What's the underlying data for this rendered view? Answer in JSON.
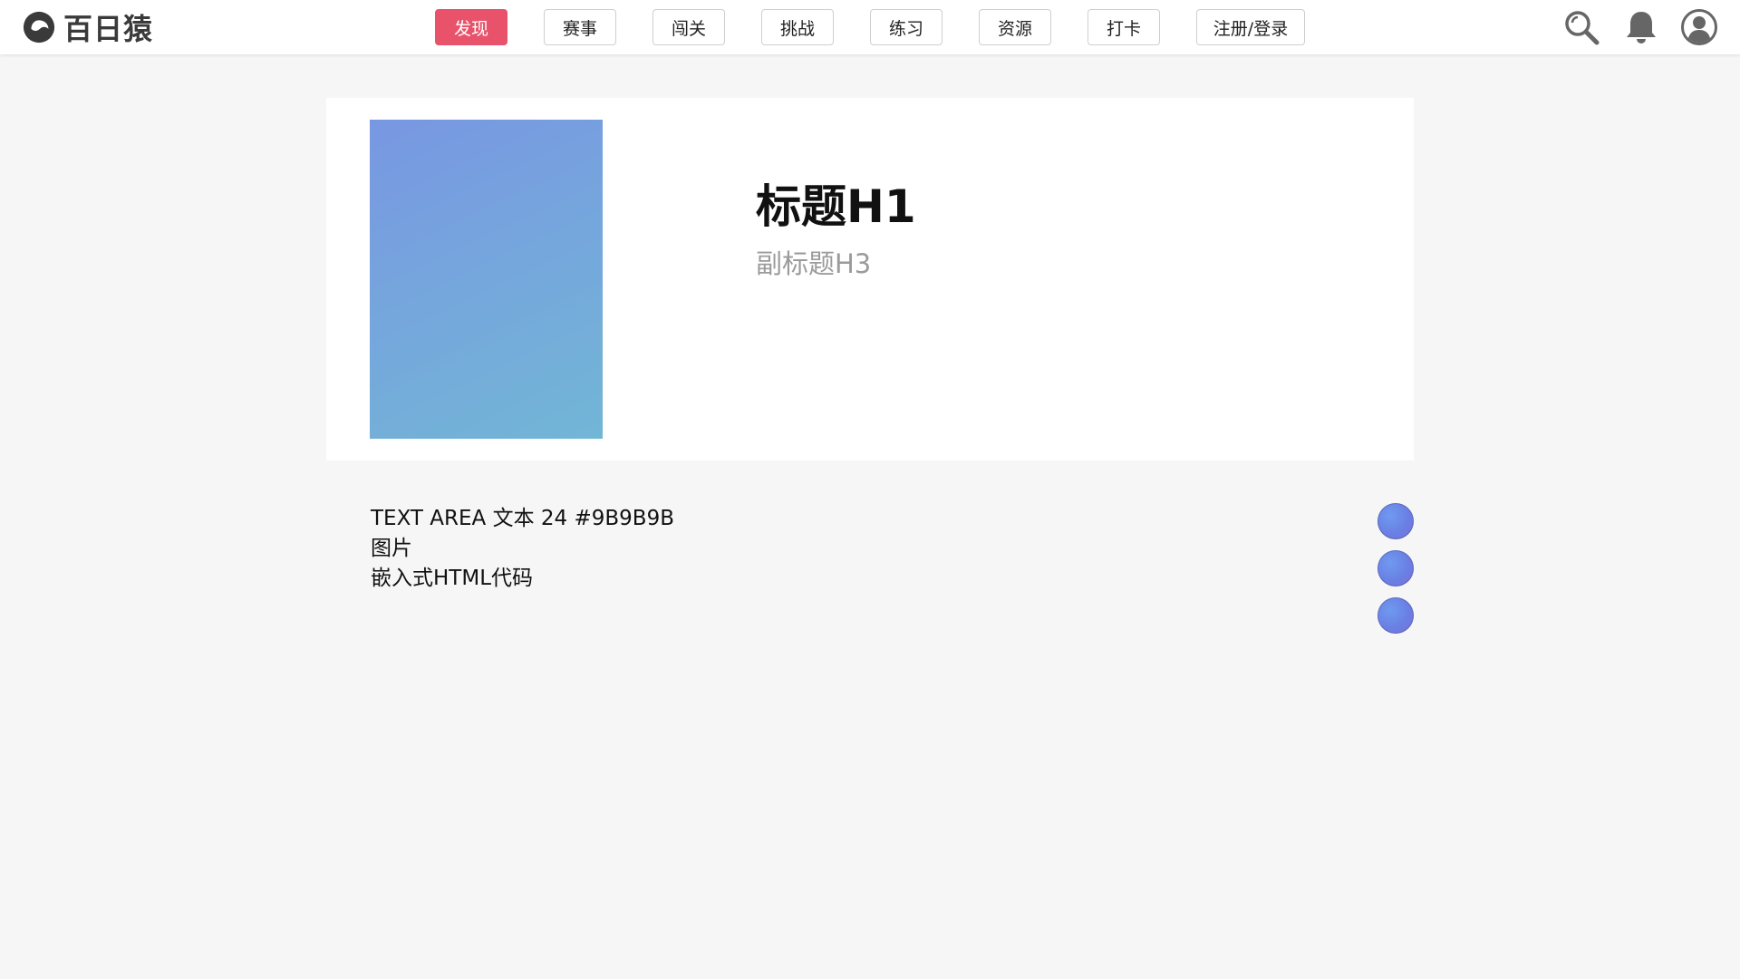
{
  "header": {
    "logo_text": "百日猿",
    "nav": [
      {
        "label": "发现"
      },
      {
        "label": "赛事"
      },
      {
        "label": "闯关"
      },
      {
        "label": "挑战"
      },
      {
        "label": "练习"
      },
      {
        "label": "资源"
      },
      {
        "label": "打卡"
      },
      {
        "label": "注册/登录"
      }
    ],
    "active_tab": "发现",
    "accent_color": "#e8536b",
    "icons": [
      "search-icon",
      "bell-icon",
      "user-icon"
    ]
  },
  "hero": {
    "title": "标题H1",
    "subtitle": "副标题H3",
    "subtitle_color": "#9b9b9b"
  },
  "content": {
    "lines": [
      "TEXT AREA 文本 24 #9B9B9B",
      "图片",
      "嵌入式HTML代码"
    ]
  },
  "side_actions": [
    "action-dot-1",
    "action-dot-2",
    "action-dot-3"
  ]
}
